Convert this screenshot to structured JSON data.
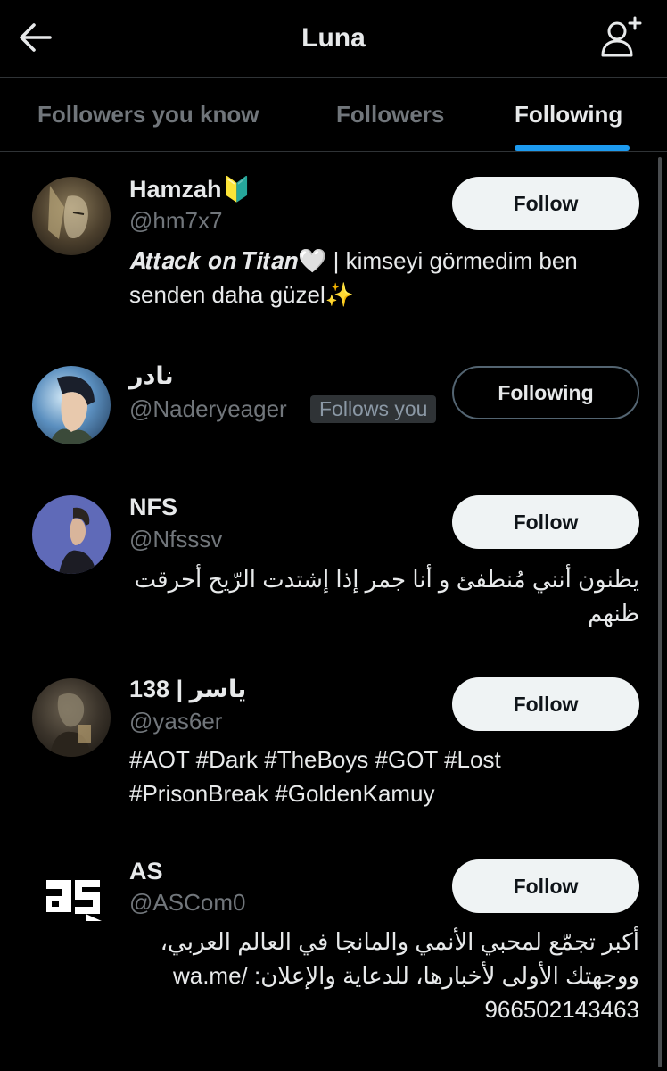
{
  "header": {
    "title": "Luna",
    "back_icon": "arrow-left-icon",
    "add_icon": "add-user-icon"
  },
  "tabs": [
    {
      "label": "Followers you know",
      "active": false
    },
    {
      "label": "Followers",
      "active": false
    },
    {
      "label": "Following",
      "active": true
    }
  ],
  "colors": {
    "background": "#000000",
    "text": "#e7e9ea",
    "muted": "#71767b",
    "accent": "#1d9bf0",
    "button_bg": "#eff3f4"
  },
  "users": [
    {
      "name": "Hamzah🔰",
      "handle": "@hm7x7",
      "follows_you": "",
      "button": "Follow",
      "bio": "𝑨𝒕𝒕𝒂𝒄𝒌 𝒐𝒏 𝑻𝒊𝒕𝒂𝒏🤍 | kimseyi görmedim ben senden daha güzel✨"
    },
    {
      "name": "نادر",
      "handle": "@Naderyeager",
      "follows_you": "Follows you",
      "button": "Following",
      "bio": ""
    },
    {
      "name": "NFS",
      "handle": "@Nfsssv",
      "follows_you": "",
      "button": "Follow",
      "bio": "يظنون أنني مُنطفئ و أنا جمر إذا إشتدت الرّيح أحرقت ظنهم"
    },
    {
      "name": "ياسر | 138",
      "handle": "@yas6er",
      "follows_you": "",
      "button": "Follow",
      "bio": "#AOT #Dark #TheBoys #GOT #Lost #PrisonBreak #GoldenKamuy"
    },
    {
      "name": "AS",
      "handle": "@ASCom0",
      "follows_you": "",
      "button": "Follow",
      "bio": "أكبر تجمّع لمحبي الأنمي والمانجا في العالم العربي، ووجهتك الأولى لأخبارها، للدعاية والإعلان: /wa.me 966502143463"
    }
  ]
}
